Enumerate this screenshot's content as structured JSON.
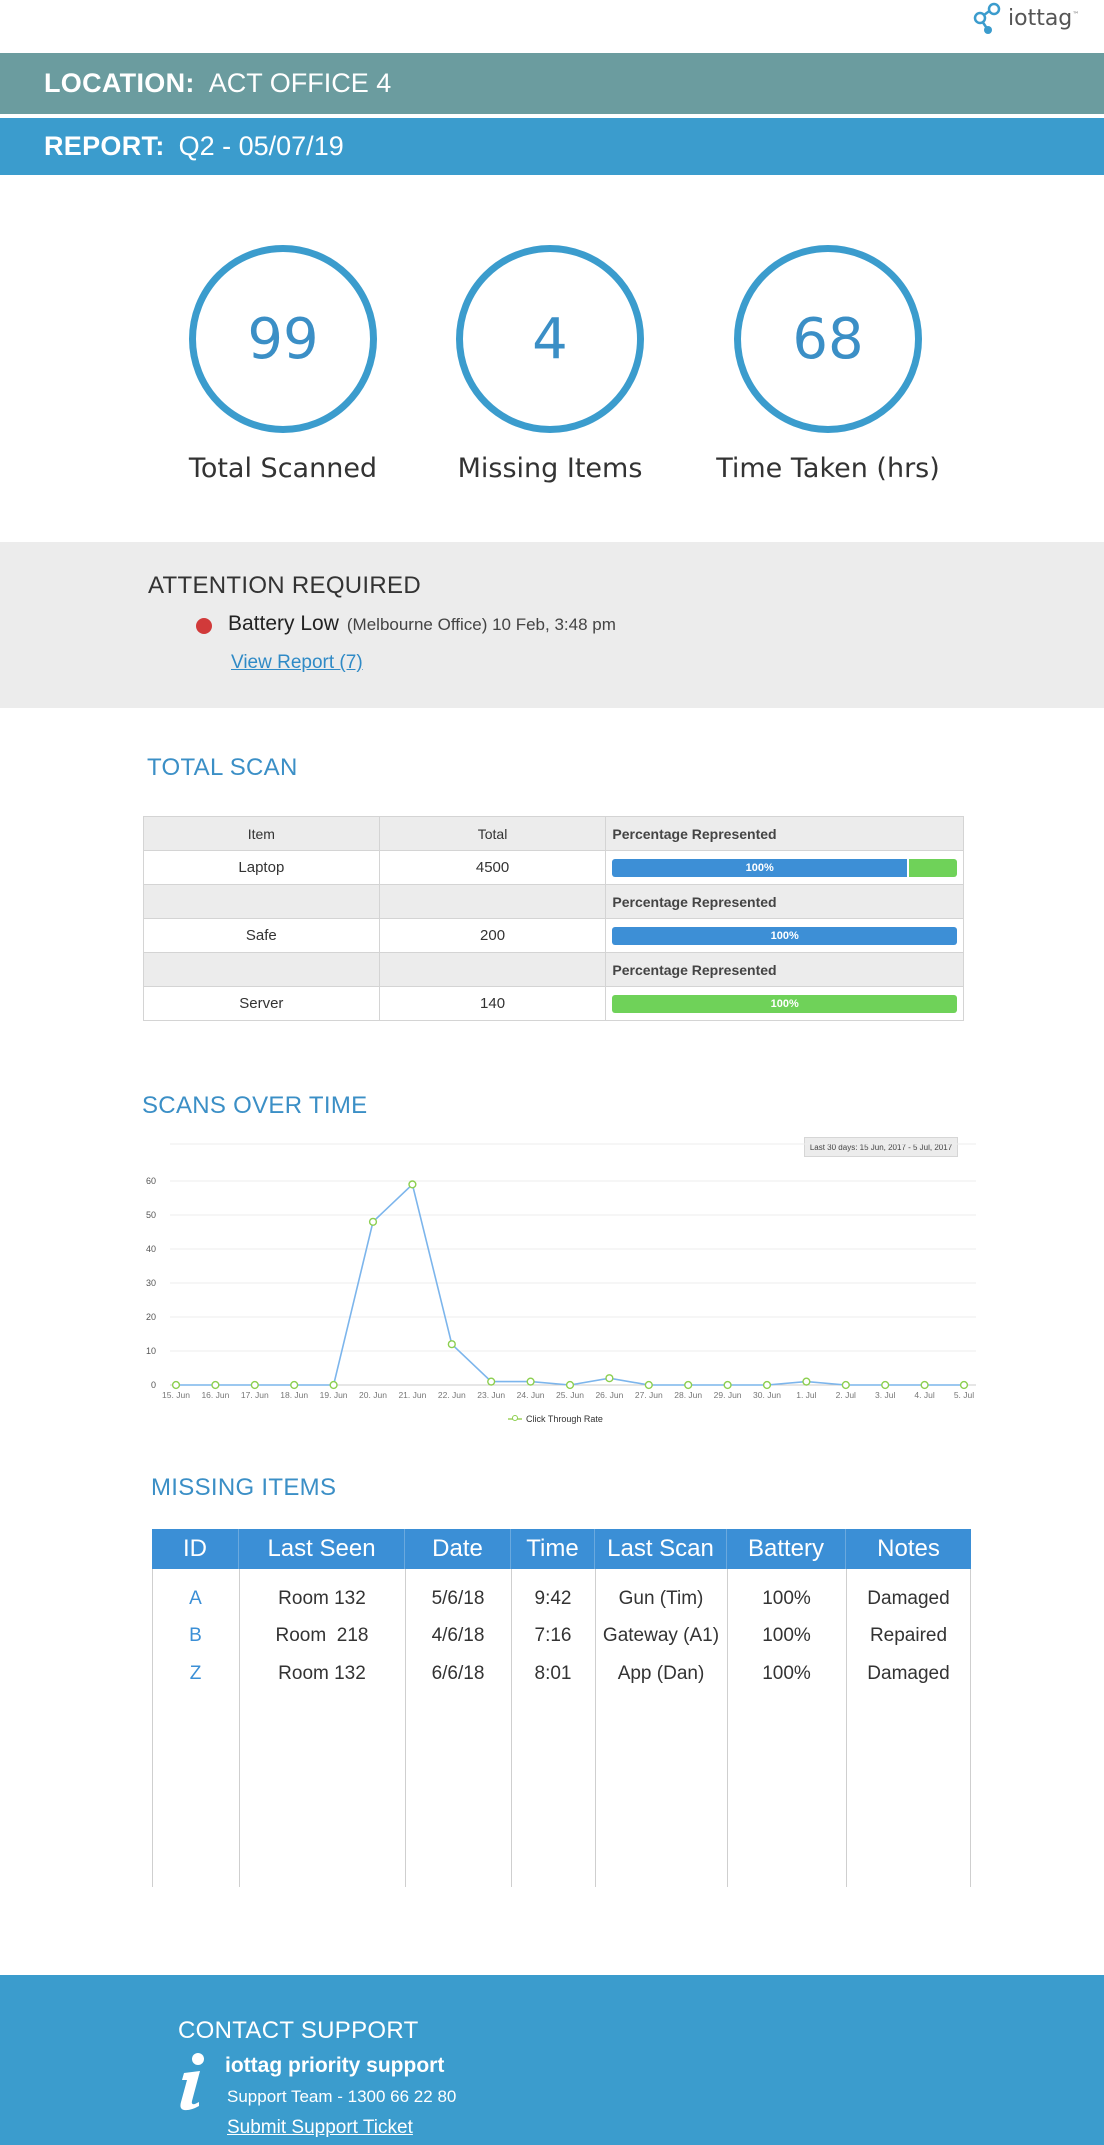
{
  "brand": {
    "name": "iottag",
    "tm": "™",
    "icon": "iottag-logo-icon"
  },
  "location": {
    "label": "LOCATION:",
    "value": "ACT OFFICE 4"
  },
  "report": {
    "label": "REPORT:",
    "value": "Q2 - 05/07/19"
  },
  "stats": [
    {
      "value": "99",
      "label": "Total Scanned"
    },
    {
      "value": "4",
      "label": "Missing Items"
    },
    {
      "value": "68",
      "label": "Time Taken (hrs)"
    }
  ],
  "attention": {
    "title": "ATTENTION REQUIRED",
    "item": "Battery Low",
    "meta": "(Melbourne Office) 10 Feb, 3:48 pm",
    "link": "View Report (7)",
    "dot_color": "#d13a3a"
  },
  "total_scan": {
    "title": "TOTAL SCAN",
    "headers": [
      "Item",
      "Total",
      "Percentage Represented"
    ],
    "pct_header": "Percentage Represented",
    "rows": [
      {
        "item": "Laptop",
        "total": "4500",
        "pct_label": "100%",
        "blue": 0.86,
        "green": 0.14
      },
      {
        "item": "Safe",
        "total": "200",
        "pct_label": "100%",
        "blue": 1.0,
        "green": 0
      },
      {
        "item": "Server",
        "total": "140",
        "pct_label": "100%",
        "blue": 0,
        "green": 1.0
      }
    ]
  },
  "scans_over_time": {
    "title": "SCANS OVER TIME",
    "range_label": "Last 30 days: 15 Jun, 2017 - 5 Jul, 2017",
    "legend": "Click Through Rate"
  },
  "chart_data": {
    "type": "line",
    "categories": [
      "15. Jun",
      "16. Jun",
      "17. Jun",
      "18. Jun",
      "19. Jun",
      "20. Jun",
      "21. Jun",
      "22. Jun",
      "23. Jun",
      "24. Jun",
      "25. Jun",
      "26. Jun",
      "27. Jun",
      "28. Jun",
      "29. Jun",
      "30. Jun",
      "1. Jul",
      "2. Jul",
      "3. Jul",
      "4. Jul",
      "5. Jul"
    ],
    "series": [
      {
        "name": "Click Through Rate",
        "values": [
          0,
          0,
          0,
          0,
          0,
          48,
          59,
          12,
          1,
          1,
          0,
          2,
          0,
          0,
          0,
          0,
          1,
          0,
          0,
          0,
          0
        ]
      }
    ],
    "yticks": [
      0,
      10,
      20,
      30,
      40,
      50,
      60
    ],
    "ylim": [
      0,
      60
    ],
    "grid": true,
    "line_color": "#7cb5ec",
    "marker_color": "#8ccf4f"
  },
  "missing_items": {
    "title": "MISSING ITEMS",
    "headers": [
      "ID",
      "Last Seen",
      "Date",
      "Time",
      "Last Scan",
      "Battery",
      "Notes"
    ],
    "rows": [
      [
        "A",
        "Room 132",
        "5/6/18",
        "9:42",
        "Gun (Tim)",
        "100%",
        "Damaged"
      ],
      [
        "B",
        "Room  218",
        "4/6/18",
        "7:16",
        "Gateway (A1)",
        "100%",
        "Repaired"
      ],
      [
        "Z",
        "Room 132",
        "6/6/18",
        "8:01",
        "App (Dan)",
        "100%",
        "Damaged"
      ]
    ]
  },
  "footer": {
    "title": "CONTACT SUPPORT",
    "name": "iottag priority support",
    "phone": "Support Team - 1300 66 22 80",
    "link": "Submit Support Ticket",
    "icon": "info-icon"
  }
}
